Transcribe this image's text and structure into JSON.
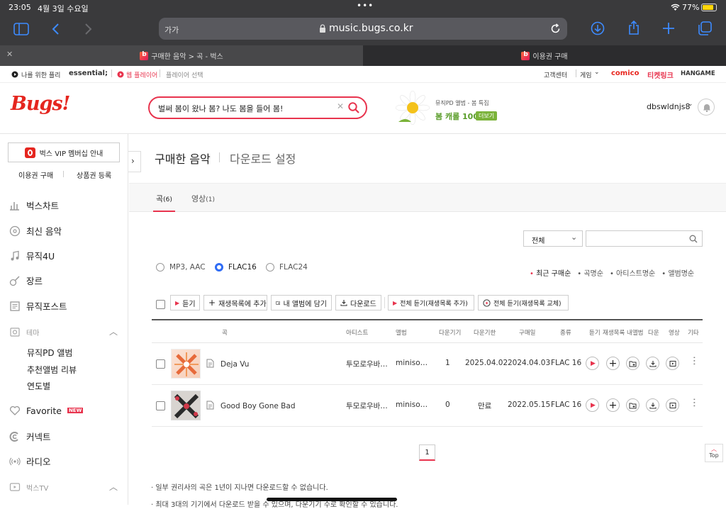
{
  "status": {
    "time": "23:05",
    "date": "4월 3일 수요일",
    "battery": "77%"
  },
  "browser": {
    "text_size": "가가",
    "url": "music.bugs.co.kr",
    "tabs": [
      {
        "title": "구매한 음악 > 곡 - 벅스"
      },
      {
        "title": "이용권 구매"
      }
    ]
  },
  "sitebar": {
    "play_for_me": "나를 위한 플리",
    "essential": "essential;",
    "web_player": "웹 플레이어",
    "player_select": "플레이어 선택",
    "customer_center": "고객센터",
    "game": "게임",
    "comico": "comico",
    "ticketlink": "티켓링크",
    "hangame": "HANGAME"
  },
  "header": {
    "logo": "Bugs!",
    "search_value": "벌써 봄이 왔나 봄? 나도 봄을 들어 봄!",
    "promo_small": "뮤직PD 앨범 - 봄 특집",
    "promo_title": "봄 캐롤 100",
    "promo_more": "더보기",
    "username": "dbswldnjs8"
  },
  "sidebar": {
    "vip_button": "벅스 VIP 멤버십 안내",
    "buy_ticket": "이용권 구매",
    "register_voucher": "상품권 등록",
    "items": [
      {
        "label": "벅스차트",
        "icon": "bar-chart-icon"
      },
      {
        "label": "최신 음악",
        "icon": "new-disc-icon"
      },
      {
        "label": "뮤직4U",
        "icon": "music-note-icon"
      },
      {
        "label": "장르",
        "icon": "guitar-icon"
      },
      {
        "label": "뮤직포스트",
        "icon": "post-icon"
      }
    ],
    "theme_label": "테마",
    "theme_items": [
      "뮤직PD 앨범",
      "추천앨범 리뷰",
      "연도별"
    ],
    "favorite": "Favorite",
    "favorite_badge": "NEW",
    "connect": "커넥트",
    "radio": "라디오",
    "bugstv": "벅스TV"
  },
  "main": {
    "title": "구매한 음악",
    "title_sep": "|",
    "download_settings": "다운로드 설정",
    "tabs": [
      {
        "label": "곡",
        "count": "(6)"
      },
      {
        "label": "영상",
        "count": "(1)"
      }
    ],
    "filter_select": "전체",
    "search_placeholder": "",
    "formats": [
      {
        "label": "MP3, AAC",
        "selected": false
      },
      {
        "label": "FLAC16",
        "selected": true
      },
      {
        "label": "FLAC24",
        "selected": false
      }
    ],
    "sorts": [
      "최근 구매순",
      "곡명순",
      "아티스트명순",
      "앨범명순"
    ],
    "actions": {
      "listen": "듣기",
      "add_playlist": "재생목록에 추가",
      "add_album": "내 앨범에 담기",
      "download": "다운로드",
      "listen_all_add": "전체 듣기(재생목록 추가)",
      "listen_all_replace": "전체 듣기(재생목록 교체)"
    },
    "columns": [
      "곡",
      "아티스트",
      "앨범",
      "다운기기",
      "다운기한",
      "구매일",
      "종류",
      "듣기",
      "재생목록",
      "내앨범",
      "다운",
      "영상",
      "기타"
    ],
    "rows": [
      {
        "title": "Deja Vu",
        "artist": "투모로우바…",
        "album": "miniso…",
        "devices": "1",
        "deadline": "2025.04.02",
        "purchased": "2024.04.03",
        "type": "FLAC 16"
      },
      {
        "title": "Good Boy Gone Bad",
        "artist": "투모로우바…",
        "album": "miniso…",
        "devices": "0",
        "deadline": "만료",
        "purchased": "2022.05.15",
        "type": "FLAC 16"
      }
    ],
    "page": "1",
    "top": "Top",
    "notes": [
      "일부 권리사의 곡은 1년이 지나면 다운로드할 수 없습니다.",
      "최대 3대의 기기에서 다운로드 받을 수 있으며, 다운기기 수로 확인할 수 있습니다."
    ]
  },
  "colors": {
    "accent": "#e8344e",
    "bugs_red": "#e5261f",
    "radio_blue": "#2f6cf5",
    "chrome": "#3a3a3c"
  }
}
